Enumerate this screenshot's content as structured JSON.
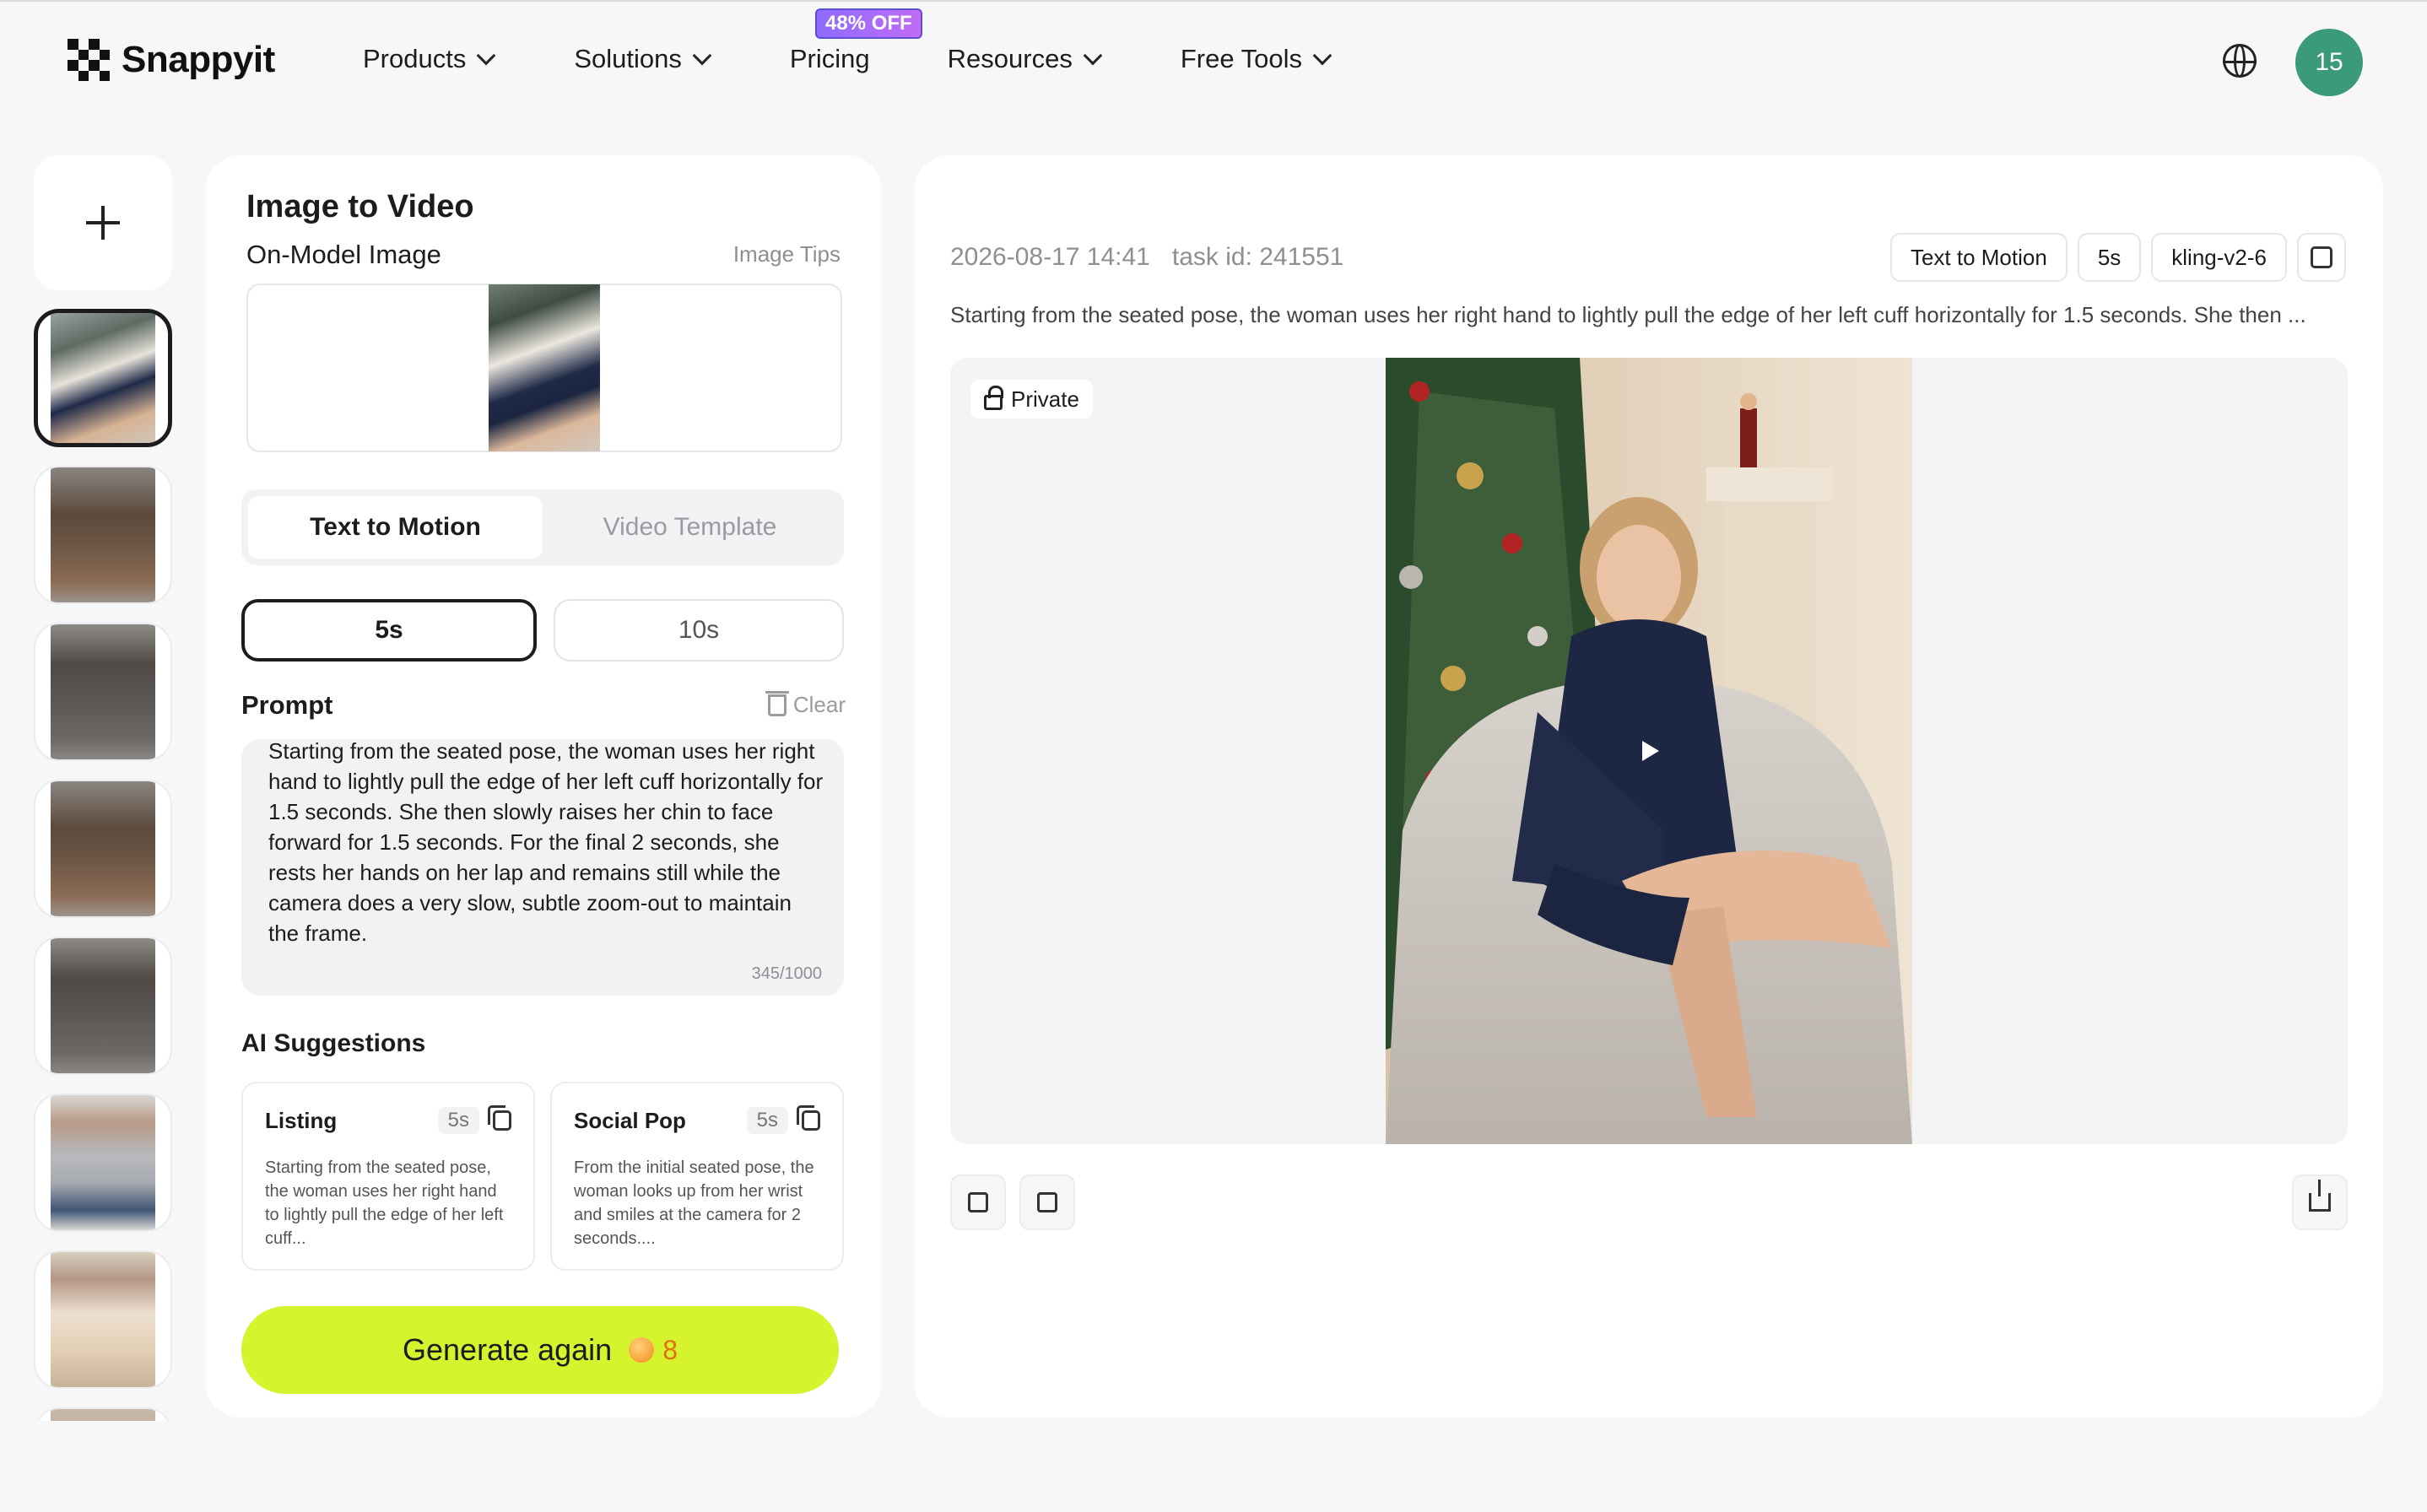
{
  "brand": {
    "name": "Snappyit"
  },
  "nav": {
    "items": [
      {
        "label": "Products",
        "has_menu": true
      },
      {
        "label": "Solutions",
        "has_menu": true
      },
      {
        "label": "Pricing",
        "has_menu": false
      },
      {
        "label": "Resources",
        "has_menu": true
      },
      {
        "label": "Free Tools",
        "has_menu": true
      }
    ],
    "pricing_badge": "48% OFF",
    "avatar_initials": "15",
    "globe_icon": "globe-icon"
  },
  "rail": {
    "add_icon": "plus-icon",
    "thumbnail_count": 8,
    "active_index": 0
  },
  "left_panel": {
    "title": "Image to Video",
    "image_label": "On-Model Image",
    "image_tips": "Image Tips",
    "mode_tabs": [
      {
        "label": "Text to Motion",
        "active": true
      },
      {
        "label": "Video Template",
        "active": false
      }
    ],
    "durations": [
      {
        "label": "5s",
        "active": true
      },
      {
        "label": "10s",
        "active": false
      }
    ],
    "prompt_label": "Prompt",
    "clear_label": "Clear",
    "prompt_text": "Starting from the seated pose, the woman uses her right hand to lightly pull the edge of her left cuff horizontally for 1.5 seconds. She then slowly raises her chin to face forward for 1.5 seconds. For the final 2 seconds, she rests her hands on her lap and remains still while the camera does a very slow, subtle zoom-out to maintain the frame.",
    "prompt_count": "345/1000",
    "ai_label": "AI Suggestions",
    "suggestions": [
      {
        "title": "Listing",
        "duration": "5s",
        "text": "Starting from the seated pose, the woman uses her right hand to lightly pull the edge of her left cuff..."
      },
      {
        "title": "Social Pop",
        "duration": "5s",
        "text": "From the initial seated pose, the woman looks up from her wrist and smiles at the camera for 2 seconds...."
      }
    ],
    "generate_label": "Generate again",
    "generate_cost": "8"
  },
  "right_panel": {
    "timestamp": "2026-08-17 14:41",
    "task_id": "task id: 241551",
    "tags": [
      "Text to Motion",
      "5s",
      "kling-v2-6"
    ],
    "description": "Starting from the seated pose, the woman uses her right hand to lightly pull the edge of her left cuff horizontally for 1.5 seconds. She then ...",
    "private_label": "Private"
  },
  "colors": {
    "accent": "#d6f42d",
    "avatar": "#3a9a7a",
    "badge": "#8f6bff",
    "cost": "#e46d12"
  }
}
